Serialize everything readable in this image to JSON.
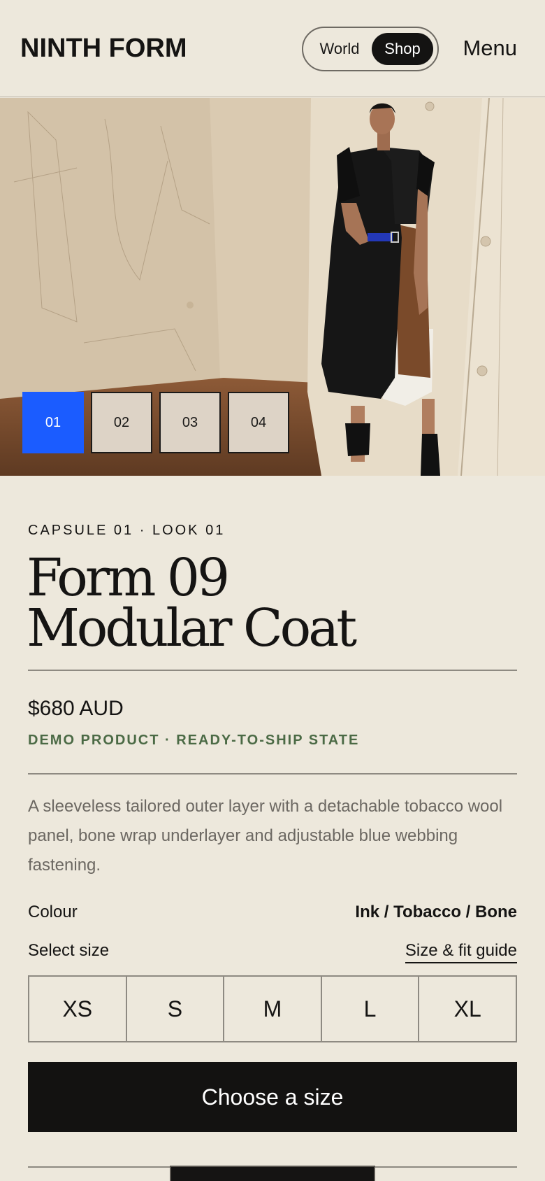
{
  "header": {
    "logo": "NINTH FORM",
    "toggle": {
      "world_label": "World",
      "shop_label": "Shop",
      "selected": "Shop"
    },
    "menu_label": "Menu"
  },
  "gallery": {
    "thumbnails": [
      "01",
      "02",
      "03",
      "04"
    ],
    "active": "01",
    "accent_color": "#1b5cff"
  },
  "product": {
    "eyebrow": "CAPSULE 01 · LOOK 01",
    "title_line1": "Form 09",
    "title_line2": "Modular Coat",
    "price": "$680 AUD",
    "state": "DEMO PRODUCT · READY-TO-SHIP STATE",
    "state_color": "#4b6a45",
    "description": "A sleeveless tailored outer layer with a detachable tobacco wool panel, bone wrap underlayer and adjustable blue webbing fastening.",
    "colour_label": "Colour",
    "colour_value": "Ink / Tobacco / Bone",
    "size_label": "Select size",
    "size_guide_label": "Size & fit guide",
    "sizes": [
      "XS",
      "S",
      "M",
      "L",
      "XL"
    ],
    "cta_label": "Choose a size"
  }
}
